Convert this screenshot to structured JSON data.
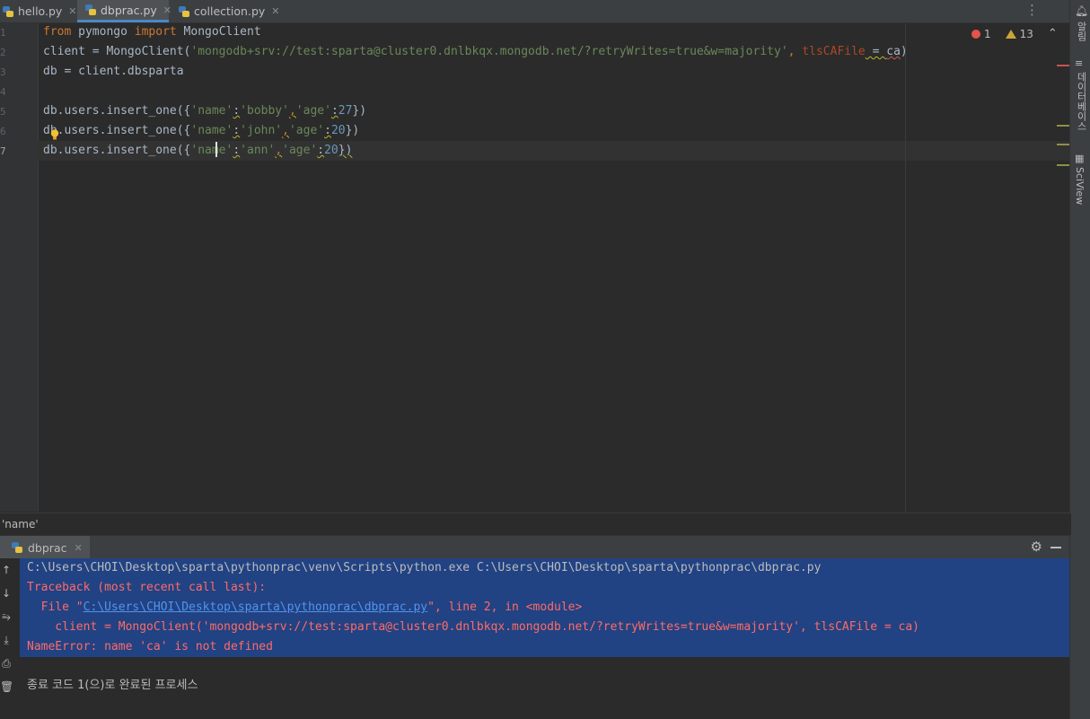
{
  "tabs": [
    {
      "label": "hello.py",
      "active": false
    },
    {
      "label": "dbprac.py",
      "active": true
    },
    {
      "label": "collection.py",
      "active": false
    }
  ],
  "inspections": {
    "errors": "1",
    "warnings": "13"
  },
  "gutter": {
    "line_numbers": [
      "1",
      "2",
      "3",
      "4",
      "5",
      "6",
      "7"
    ]
  },
  "code": {
    "l1": {
      "kw_from": "from",
      "mod": " pymongo ",
      "kw_import": "import",
      "cls": " MongoClient"
    },
    "l2": {
      "pre": "client = MongoClient(",
      "str": "'mongodb+srv://test:sparta@cluster0.dnlbkqx.mongodb.net/?retryWrites=true&w=majority'",
      "comma": ",",
      "param": " tlsCAFile",
      "eq": " = ",
      "var": "ca",
      "close": ")"
    },
    "l3": {
      "text": "db = client.dbsparta"
    },
    "l5": {
      "pre": "db.users.insert_one({",
      "k1": "'name'",
      "c1": ":",
      "v1": "'bobby'",
      "s1": ",",
      "k2": "'age'",
      "c2": ":",
      "v2": "27",
      "close": "})"
    },
    "l6": {
      "pre_a": "d",
      "pre_b": "b.users.insert_one({",
      "k1": "'name'",
      "c1": ":",
      "v1": "'john'",
      "s1": ",",
      "k2": "'age'",
      "c2": ":",
      "v2": "20",
      "close": "})"
    },
    "l7": {
      "pre": "db.users.insert_one({",
      "k1a": "'na",
      "k1b": "me'",
      "c1": ":",
      "v1": "'ann'",
      "s1": ",",
      "k2": "'age'",
      "c2": ":",
      "v2": "20",
      "close": "})"
    }
  },
  "breadcrumb": "'name'",
  "right_stripe": {
    "notifications": "알림",
    "database": "데이터베이스",
    "sciview": "SciView"
  },
  "run_panel": {
    "tab_label": "dbprac",
    "console": {
      "cmd": "C:\\Users\\CHOI\\Desktop\\sparta\\pythonprac\\venv\\Scripts\\python.exe C:\\Users\\CHOI\\Desktop\\sparta\\pythonprac\\dbprac.py",
      "traceback": "Traceback (most recent call last):",
      "file_prefix": "  File \"",
      "file_link": "C:\\Users\\CHOI\\Desktop\\sparta\\pythonprac\\dbprac.py",
      "file_suffix": "\", line 2, in <module>",
      "code_line": "    client = MongoClient('mongodb+srv://test:sparta@cluster0.dnlbkqx.mongodb.net/?retryWrites=true&w=majority', tlsCAFile = ca)",
      "error": "NameError: name 'ca' is not defined",
      "exit": "종료 코드 1(으)로 완료된 프로세스"
    }
  },
  "colors": {
    "keyword": "#cc7832",
    "string": "#6a8759",
    "number": "#6897bb",
    "error": "#ff6b68",
    "link": "#5394ec",
    "selection": "#214283"
  }
}
